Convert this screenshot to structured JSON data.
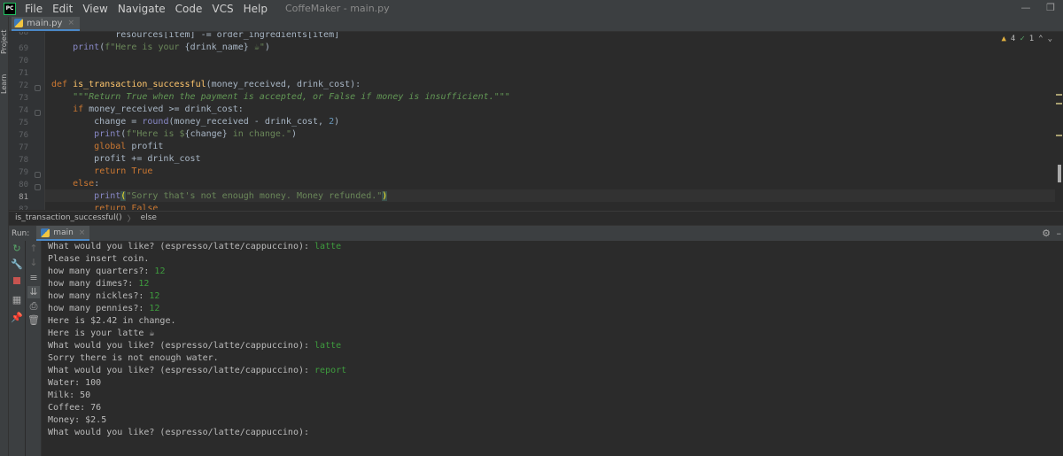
{
  "menubar": {
    "logo": "PC",
    "items": [
      "File",
      "Edit",
      "View",
      "Navigate",
      "Code",
      "VCS",
      "Help"
    ],
    "window_title": "CoffeMaker - main.py",
    "minimize": "—",
    "restore": "❐"
  },
  "side_tabs": {
    "project": "Project",
    "learn": "Learn"
  },
  "editor_tab": {
    "filename": "main.py",
    "close": "×"
  },
  "inspection": {
    "warnings": "4",
    "ok": "1"
  },
  "editor": {
    "line_numbers": [
      "68",
      "69",
      "70",
      "71",
      "72",
      "73",
      "74",
      "75",
      "76",
      "77",
      "78",
      "79",
      "80",
      "81",
      "82"
    ],
    "current_line": "81"
  },
  "breadcrumb": {
    "function": "is_transaction_successful()",
    "branch": "else"
  },
  "run": {
    "label": "Run:",
    "config": "main",
    "close": "×"
  },
  "console": {
    "lines": [
      {
        "text": "What would you like? (espresso/latte/cappuccino): ",
        "input": "latte"
      },
      {
        "text": "Please insert coin.",
        "input": ""
      },
      {
        "text": "how many quarters?: ",
        "input": "12"
      },
      {
        "text": "how many dimes?: ",
        "input": "12"
      },
      {
        "text": "how many nickles?: ",
        "input": "12"
      },
      {
        "text": "how many pennies?: ",
        "input": "12"
      },
      {
        "text": "Here is $2.42 in change.",
        "input": ""
      },
      {
        "text": "Here is your latte ☕",
        "input": ""
      },
      {
        "text": "What would you like? (espresso/latte/cappuccino): ",
        "input": "latte"
      },
      {
        "text": "Sorry there is not enough water.",
        "input": ""
      },
      {
        "text": "What would you like? (espresso/latte/cappuccino): ",
        "input": "report"
      },
      {
        "text": "Water: 100",
        "input": ""
      },
      {
        "text": "Milk: 50",
        "input": ""
      },
      {
        "text": "Coffee: 76",
        "input": ""
      },
      {
        "text": "Money: $2.5",
        "input": ""
      },
      {
        "text": "What would you like? (espresso/latte/cappuccino): ",
        "input": ""
      }
    ]
  },
  "colors": {
    "background": "#2b2b2b",
    "panel": "#3c3f41",
    "keyword": "#cc7832",
    "function": "#ffc66d",
    "string": "#6a8759",
    "user_input": "#3e9c3e",
    "tab_underline": "#4a88c7"
  },
  "icons": {
    "rerun": "rerun-icon",
    "wrench": "wrench-icon",
    "stop": "stop-icon",
    "layout": "layout-icon",
    "pin": "pin-icon",
    "up": "arrow-up-icon",
    "down": "arrow-down-icon",
    "soft_wrap": "soft-wrap-icon",
    "scroll_end": "scroll-to-end-icon",
    "print": "print-icon",
    "trash": "trash-icon",
    "settings": "gear-icon"
  }
}
